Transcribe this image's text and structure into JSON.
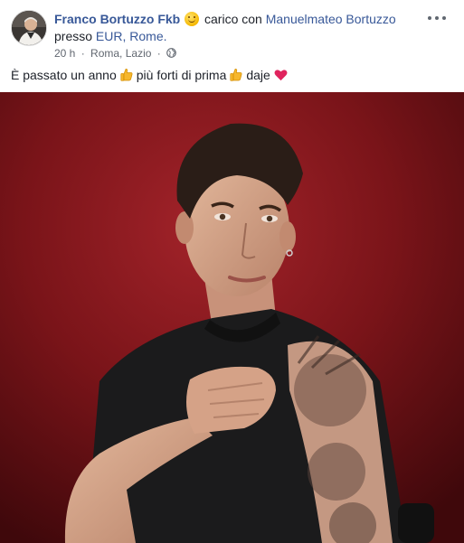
{
  "post": {
    "author": "Franco Bortuzzo Fkb",
    "feeling": "carico con",
    "tagged_user": "Manuelmateo Bortuzzo",
    "preposition": "presso",
    "place": "EUR, Rome.",
    "time": "20 h",
    "location": "Roma, Lazio",
    "separator": "·",
    "caption": {
      "part1": "È passato un anno",
      "part2": "più forti di prima",
      "part3": "daje"
    },
    "icons": {
      "feeling": "smiling-face-icon",
      "privacy": "globe-icon",
      "more": "more-options-icon",
      "thumb": "thumbs-up-emoji-icon",
      "heart": "red-heart-emoji-icon"
    },
    "colors": {
      "link": "#385898",
      "photo_background": "#7c1519",
      "heart": "#e0245e"
    }
  }
}
